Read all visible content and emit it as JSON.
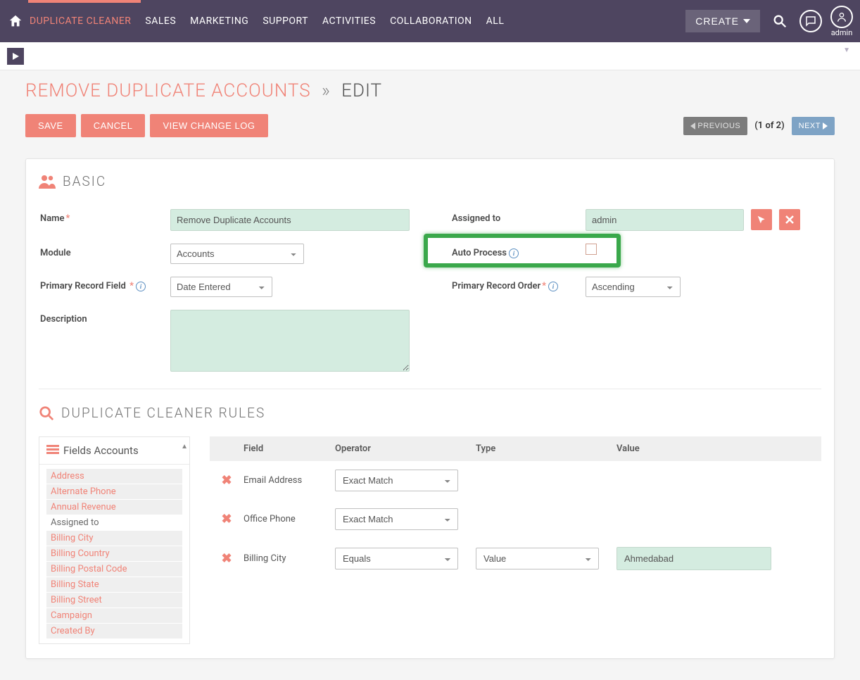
{
  "nav": {
    "items": [
      "DUPLICATE CLEANER",
      "SALES",
      "MARKETING",
      "SUPPORT",
      "ACTIVITIES",
      "COLLABORATION",
      "ALL"
    ],
    "active_index": 0,
    "create_label": "CREATE",
    "user_label": "admin"
  },
  "breadcrumb": {
    "link": "REMOVE DUPLICATE ACCOUNTS",
    "sep": "»",
    "current": "EDIT"
  },
  "actions": {
    "save": "SAVE",
    "cancel": "CANCEL",
    "view_log": "VIEW CHANGE LOG",
    "previous": "PREVIOUS",
    "next": "NEXT",
    "position": "(1 of 2)"
  },
  "basic": {
    "header": "BASIC",
    "labels": {
      "name": "Name",
      "assigned_to": "Assigned to",
      "module": "Module",
      "auto_process": "Auto Process",
      "primary_record_field": "Primary Record Field",
      "primary_record_order": "Primary Record Order",
      "description": "Description"
    },
    "values": {
      "name": "Remove Duplicate Accounts",
      "assigned_to": "admin",
      "module": "Accounts",
      "primary_record_field": "Date Entered",
      "primary_record_order": "Ascending",
      "description": "",
      "auto_process_checked": false
    }
  },
  "rules": {
    "header": "DUPLICATE CLEANER RULES",
    "fields_panel_title": "Fields Accounts",
    "field_list": [
      {
        "label": "Address",
        "link": true
      },
      {
        "label": "Alternate Phone",
        "link": true
      },
      {
        "label": "Annual Revenue",
        "link": true
      },
      {
        "label": "Assigned to",
        "link": false
      },
      {
        "label": "Billing City",
        "link": true
      },
      {
        "label": "Billing Country",
        "link": true
      },
      {
        "label": "Billing Postal Code",
        "link": true
      },
      {
        "label": "Billing State",
        "link": true
      },
      {
        "label": "Billing Street",
        "link": true
      },
      {
        "label": "Campaign",
        "link": true
      },
      {
        "label": "Created By",
        "link": true
      }
    ],
    "columns": {
      "field": "Field",
      "operator": "Operator",
      "type": "Type",
      "value": "Value"
    },
    "rows": [
      {
        "field": "Email Address",
        "operator": "Exact Match",
        "type": "",
        "value": ""
      },
      {
        "field": "Office Phone",
        "operator": "Exact Match",
        "type": "",
        "value": ""
      },
      {
        "field": "Billing City",
        "operator": "Equals",
        "type": "Value",
        "value": "Ahmedabad"
      }
    ]
  }
}
